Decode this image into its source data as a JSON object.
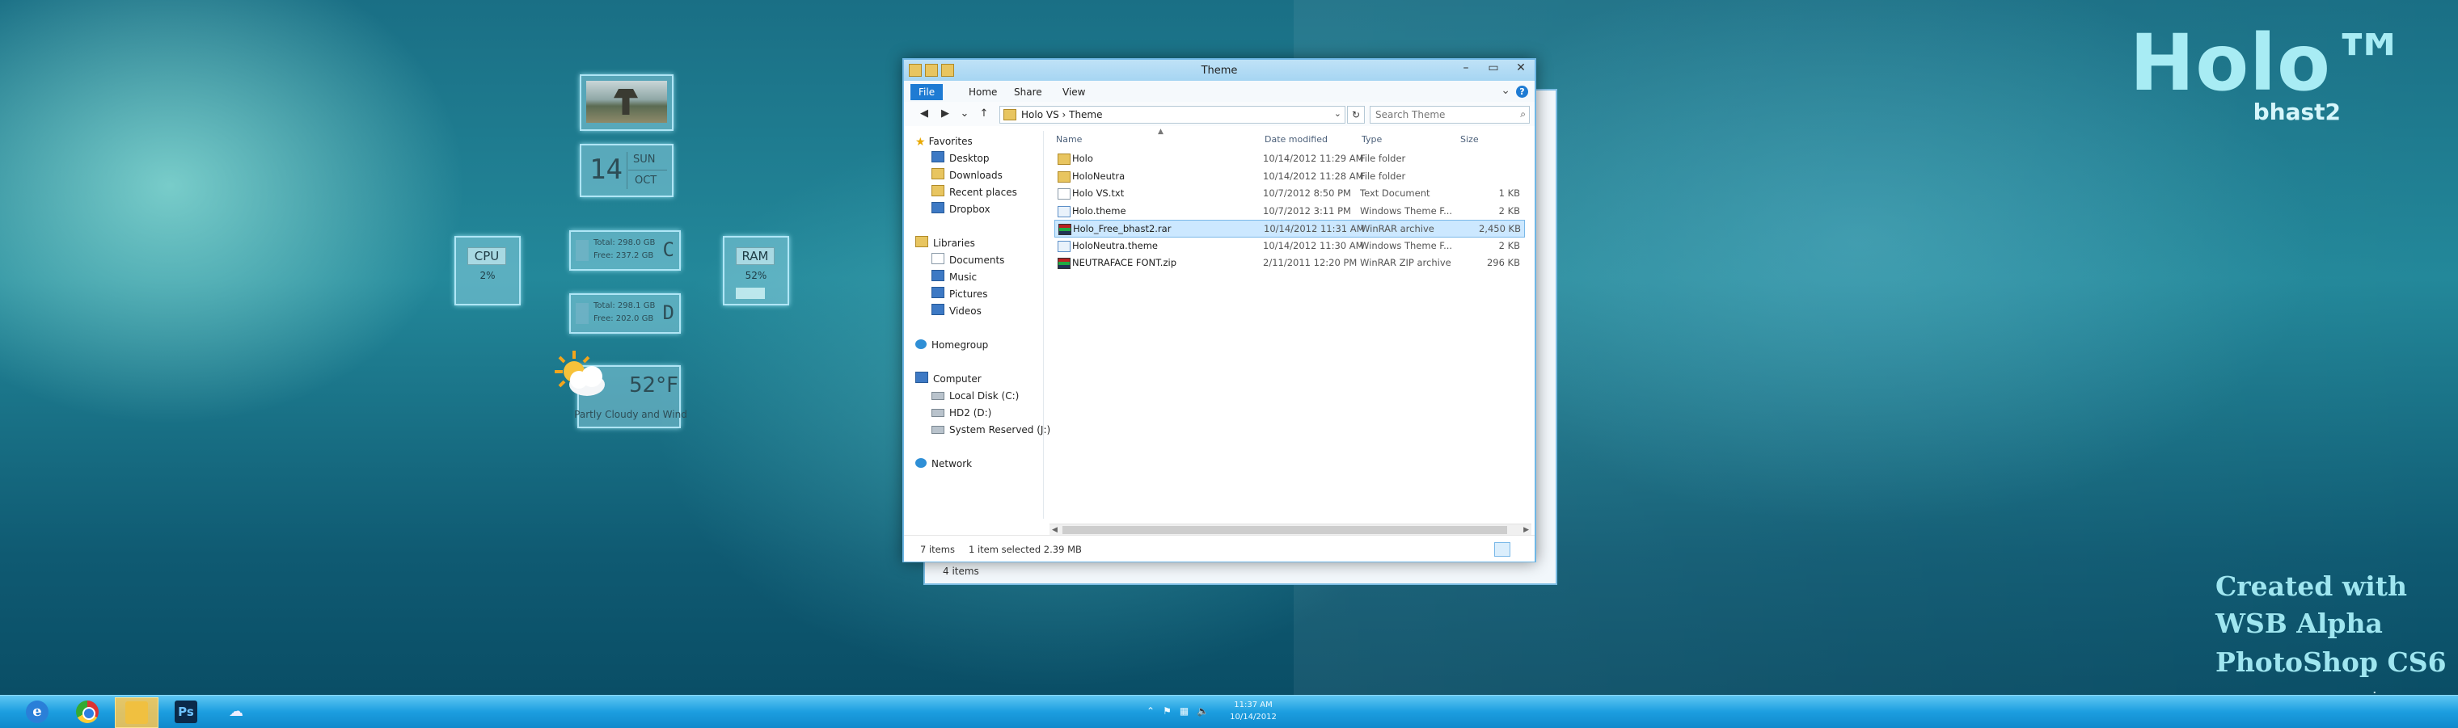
{
  "desktop": {
    "brand_title": "Holo™",
    "brand_subtitle": "bhast2",
    "credits": [
      "Created with",
      "WSB Alpha",
      "PhotoShop CS6"
    ],
    "watermark": "www.wincore.ru"
  },
  "gadgets": {
    "calendar": {
      "day": "14",
      "weekday": "SUN",
      "month": "OCT"
    },
    "cpu": {
      "label": "CPU",
      "value": "2%",
      "fraction": 0.02
    },
    "ram": {
      "label": "RAM",
      "value": "52%",
      "fraction": 0.52
    },
    "drives": [
      {
        "letter": "C",
        "total": "Total: 298.0 GB",
        "free": "Free: 237.2 GB"
      },
      {
        "letter": "D",
        "total": "Total: 298.1 GB",
        "free": "Free: 202.0 GB"
      }
    ],
    "weather": {
      "temp": "52°F",
      "desc": "Partly Cloudy and Wind"
    }
  },
  "back_window": {
    "status": "4 items"
  },
  "explorer": {
    "title": "Theme",
    "ribbon_tabs": [
      "File",
      "Home",
      "Share",
      "View"
    ],
    "address": {
      "path": "Holo VS  ›  Theme",
      "root_chevron": "›"
    },
    "search_placeholder": "Search Theme",
    "nav": {
      "favorites": "Favorites",
      "favorites_items": [
        "Desktop",
        "Downloads",
        "Recent places",
        "Dropbox"
      ],
      "libraries": "Libraries",
      "libraries_items": [
        "Documents",
        "Music",
        "Pictures",
        "Videos"
      ],
      "homegroup": "Homegroup",
      "computer": "Computer",
      "computer_items": [
        "Local Disk (C:)",
        "HD2 (D:)",
        "System Reserved (J:)"
      ],
      "network": "Network"
    },
    "columns": {
      "name": "Name",
      "date": "Date modified",
      "type": "Type",
      "size": "Size"
    },
    "files": [
      {
        "name": "Holo",
        "date": "10/14/2012 11:29 AM",
        "type": "File folder",
        "size": "",
        "icon": "folder-icon"
      },
      {
        "name": "HoloNeutra",
        "date": "10/14/2012 11:28 AM",
        "type": "File folder",
        "size": "",
        "icon": "folder-icon"
      },
      {
        "name": "Holo VS.txt",
        "date": "10/7/2012 8:50 PM",
        "type": "Text Document",
        "size": "1 KB",
        "icon": "text-file-icon"
      },
      {
        "name": "Holo.theme",
        "date": "10/7/2012 3:11 PM",
        "type": "Windows Theme F...",
        "size": "2 KB",
        "icon": "theme-file-icon"
      },
      {
        "name": "Holo_Free_bhast2.rar",
        "date": "10/14/2012 11:31 AM",
        "type": "WinRAR archive",
        "size": "2,450 KB",
        "icon": "rar-archive-icon"
      },
      {
        "name": "HoloNeutra.theme",
        "date": "10/14/2012 11:30 AM",
        "type": "Windows Theme F...",
        "size": "2 KB",
        "icon": "theme-file-icon"
      },
      {
        "name": "NEUTRAFACE FONT.zip",
        "date": "2/11/2011 12:20 PM",
        "type": "WinRAR ZIP archive",
        "size": "296 KB",
        "icon": "rar-archive-icon"
      }
    ],
    "selected_file": 4,
    "status": {
      "items": "7 items",
      "selected": "1 item selected  2.39 MB"
    }
  },
  "taskbar": {
    "apps": [
      "internet-explorer",
      "chrome",
      "file-explorer",
      "photoshop",
      "other"
    ],
    "ps_label": "Ps",
    "ie_label": "e",
    "clock_time": "11:37 AM",
    "clock_date": "10/14/2012"
  },
  "colors": {
    "window_border": "#6fb7e5",
    "accent": "#1e7bd3",
    "taskbar": "#1c9ee0",
    "brand_text": "#a8ecf4"
  }
}
